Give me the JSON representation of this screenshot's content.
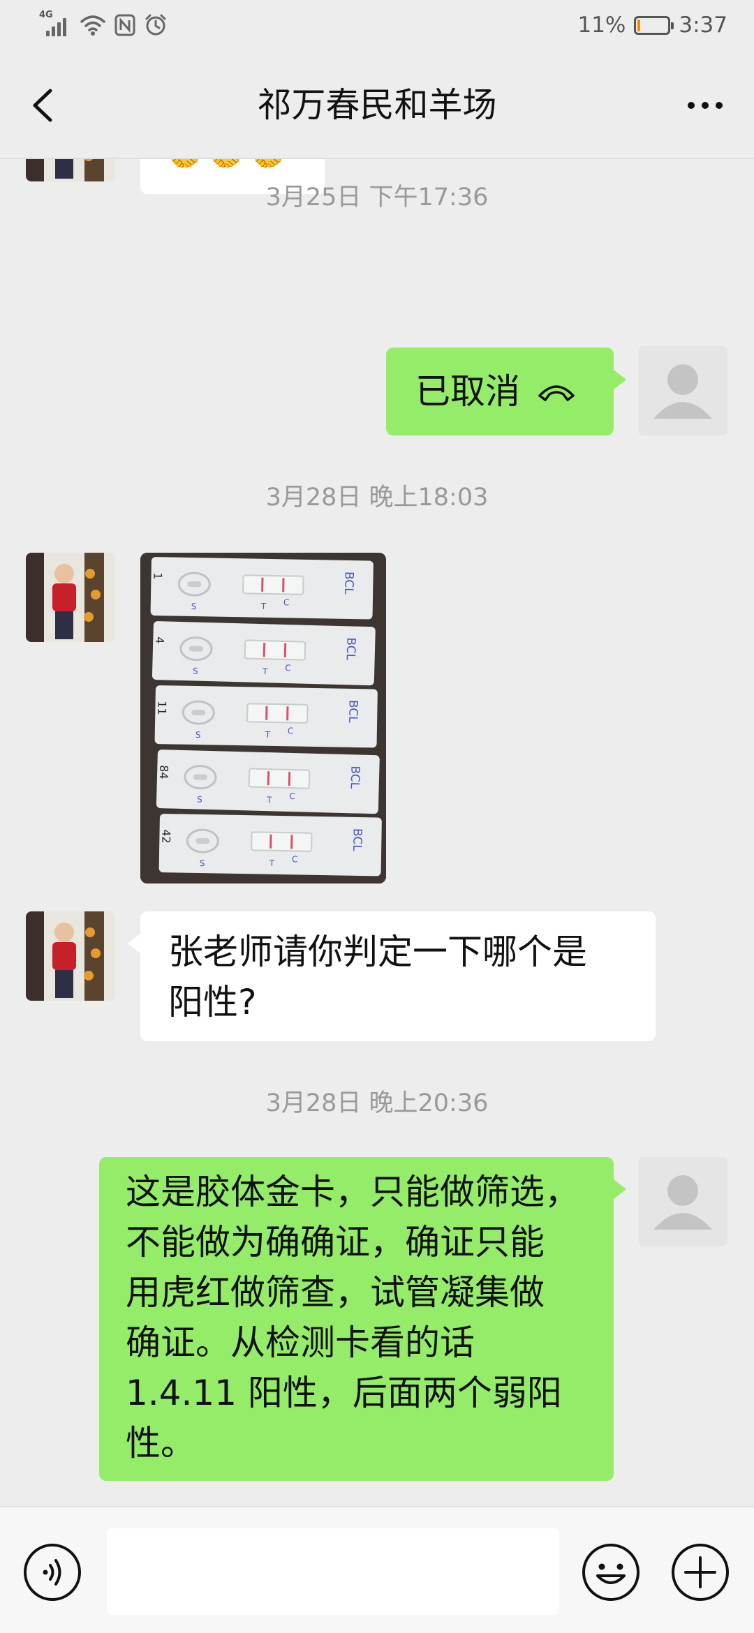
{
  "status_bar": {
    "network": "4G",
    "battery": "11%",
    "battery_level": 0.11,
    "time": "3:37",
    "icons": [
      "signal-icon",
      "wifi-icon",
      "nfc-icon",
      "alarm-icon",
      "battery-icon"
    ]
  },
  "header": {
    "title": "祁万春民和羊场",
    "back_icon": "chevron-left-icon",
    "more_icon": "more-dots-icon"
  },
  "messages": [
    {
      "type": "emoji",
      "from": "other",
      "text": "🤝🤝🤝"
    },
    {
      "type": "timestamp",
      "text": "3月25日 下午17:36"
    },
    {
      "type": "call",
      "from": "me",
      "text": "已取消",
      "icon": "hangup-icon"
    },
    {
      "type": "timestamp",
      "text": "3月28日 晚上18:03"
    },
    {
      "type": "image",
      "from": "other",
      "cards": [
        {
          "label": "BCL",
          "c": "C",
          "t": "T",
          "s": "S",
          "mark": "1"
        },
        {
          "label": "BCL",
          "c": "C",
          "t": "T",
          "s": "S",
          "mark": "4"
        },
        {
          "label": "BCL",
          "c": "C",
          "t": "T",
          "s": "S",
          "mark": "11"
        },
        {
          "label": "BCL",
          "c": "C",
          "t": "T",
          "s": "S",
          "mark": "84"
        },
        {
          "label": "BCL",
          "c": "C",
          "t": "T",
          "s": "S",
          "mark": "42"
        }
      ]
    },
    {
      "type": "text",
      "from": "other",
      "lines": [
        "张老师请你判定一下哪个是",
        "阳性?"
      ]
    },
    {
      "type": "timestamp",
      "text": "3月28日 晚上20:36"
    },
    {
      "type": "text",
      "from": "me",
      "lines": [
        "这是胶体金卡，只能做筛选，",
        "不能做为确确证，确证只能",
        "用虎红做筛查，试管凝集做",
        "确证。从检测卡看的话",
        "1.4.11 阳性，后面两个弱阳",
        "性。"
      ]
    }
  ],
  "input_bar": {
    "voice_icon": "voice-icon",
    "text_value": "",
    "emoji_icon": "emoji-icon",
    "plus_icon": "plus-icon"
  },
  "colors": {
    "background": "#ededed",
    "outgoing_bubble": "#95ec69",
    "incoming_bubble": "#ffffff",
    "timestamp": "#999999",
    "battery_fill": "#f28a00"
  }
}
